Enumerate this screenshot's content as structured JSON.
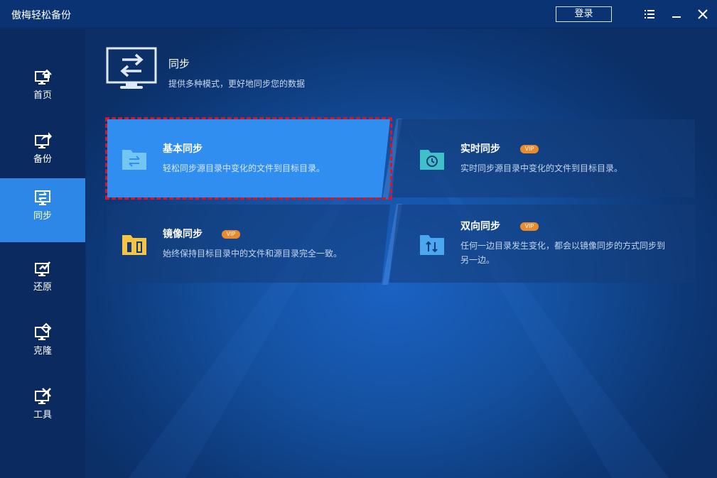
{
  "app": {
    "title": "傲梅轻松备份",
    "login_label": "登录"
  },
  "titlebar_icons": [
    "menu-icon",
    "minimize-icon",
    "close-icon"
  ],
  "sidebar": {
    "items": [
      {
        "label": "首页",
        "icon": "home-icon"
      },
      {
        "label": "备份",
        "icon": "backup-icon"
      },
      {
        "label": "同步",
        "icon": "sync-icon",
        "active": true
      },
      {
        "label": "还原",
        "icon": "restore-icon"
      },
      {
        "label": "克隆",
        "icon": "clone-icon"
      },
      {
        "label": "工具",
        "icon": "tools-icon"
      }
    ]
  },
  "header": {
    "title": "同步",
    "subtitle": "提供多种模式，更好地同步您的数据"
  },
  "cards": [
    {
      "title": "基本同步",
      "desc": "轻松同步源目录中变化的文件到目标目录。",
      "icon": "basic-sync-folder-icon",
      "selected": true
    },
    {
      "title": "实时同步",
      "desc": "实时同步源目录中变化的文件到目标目录。",
      "icon": "realtime-sync-folder-icon",
      "vip": "VIP"
    },
    {
      "title": "镜像同步",
      "desc": "始终保持目标目录中的文件和源目录完全一致。",
      "icon": "mirror-sync-folder-icon",
      "vip": "VIP"
    },
    {
      "title": "双向同步",
      "desc_line1": "任何一边目录发生变化，都会以镜像同步的方式同步到",
      "desc_line2": "另一边。",
      "icon": "two-way-sync-folder-icon",
      "vip": "VIP"
    }
  ],
  "colors": {
    "accent": "#2d87e6",
    "vip": "#e98a2c",
    "highlight_border": "#d7152b"
  }
}
